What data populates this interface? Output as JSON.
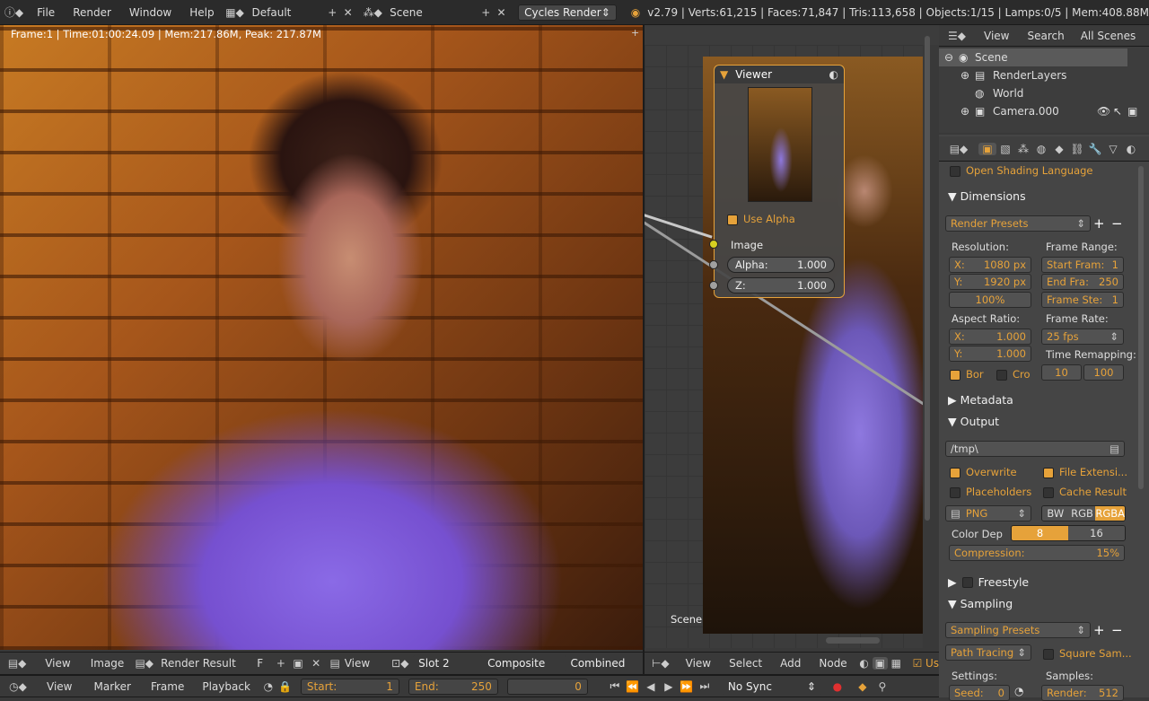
{
  "topbar": {
    "menus": [
      "File",
      "Render",
      "Window",
      "Help"
    ],
    "layout": "Default",
    "scene": "Scene",
    "engine": "Cycles Render",
    "stats": "v2.79 | Verts:61,215 | Faces:71,847 | Tris:113,658 | Objects:1/15 | Lamps:0/5 | Mem:408.88M"
  },
  "render_view": {
    "info": "Frame:1 | Time:01:00:24.09 | Mem:217.86M, Peak: 217.87M",
    "footer": {
      "view": "View",
      "image": "Image",
      "image_name": "Render Result",
      "fake": "F",
      "view2": "View",
      "slot": "Slot 2",
      "layer": "Composite",
      "pass": "Combined"
    }
  },
  "node_editor": {
    "node_title": "Viewer",
    "use_alpha": "Use Alpha",
    "image": "Image",
    "alpha_label": "Alpha:",
    "alpha_value": "1.000",
    "z_label": "Z:",
    "z_value": "1.000",
    "scene_label": "Scene",
    "footer": {
      "view": "View",
      "select": "Select",
      "add": "Add",
      "node": "Node",
      "use": "Us"
    }
  },
  "outliner": {
    "header": {
      "view": "View",
      "search": "Search",
      "scenes": "All Scenes"
    },
    "items": [
      "Scene",
      "RenderLayers",
      "World",
      "Camera.000"
    ]
  },
  "properties": {
    "osl": "Open Shading Language",
    "dimensions": "Dimensions",
    "render_presets": "Render Presets",
    "resolution": "Resolution:",
    "res_x": "X:",
    "res_x_val": "1080 px",
    "res_y": "Y:",
    "res_y_val": "1920 px",
    "res_pct": "100%",
    "frame_range": "Frame Range:",
    "start": "Start Fram:",
    "start_val": "1",
    "end": "End Fra:",
    "end_val": "250",
    "step": "Frame Ste:",
    "step_val": "1",
    "aspect": "Aspect Ratio:",
    "asp_x": "X:",
    "asp_x_val": "1.000",
    "asp_y": "Y:",
    "asp_y_val": "1.000",
    "frame_rate": "Frame Rate:",
    "fps": "25 fps",
    "time_remap": "Time Remapping:",
    "remap_old": "10",
    "remap_new": "100",
    "border": "Bor",
    "crop": "Cro",
    "metadata": "Metadata",
    "output": "Output",
    "path": "/tmp\\",
    "overwrite": "Overwrite",
    "file_ext": "File Extensi...",
    "placeholders": "Placeholders",
    "cache": "Cache Result",
    "format": "PNG",
    "bw": "BW",
    "rgb": "RGB",
    "rgba": "RGBA",
    "color_depth": "Color Dep",
    "depth8": "8",
    "depth16": "16",
    "compression": "Compression:",
    "compression_val": "15%",
    "freestyle": "Freestyle",
    "sampling": "Sampling",
    "sampling_presets": "Sampling Presets",
    "path_tracing": "Path Tracing",
    "square": "Square Sam...",
    "settings": "Settings:",
    "samples": "Samples:",
    "seed": "Seed:",
    "seed_val": "0",
    "render_s": "Render:",
    "render_s_val": "512"
  },
  "timeline": {
    "view": "View",
    "marker": "Marker",
    "frame": "Frame",
    "playback": "Playback",
    "start": "Start:",
    "start_val": "1",
    "end": "End:",
    "end_val": "250",
    "current": "0",
    "sync": "No Sync"
  }
}
